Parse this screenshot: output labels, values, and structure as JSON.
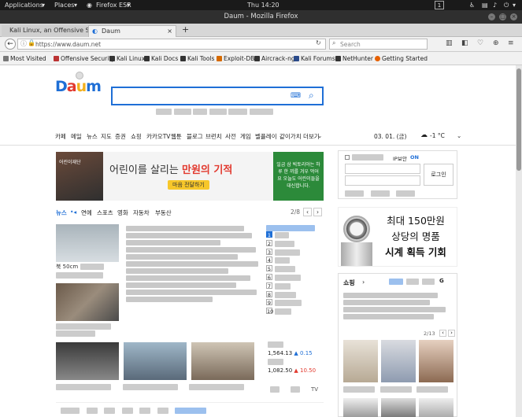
{
  "system": {
    "applications": "Applications",
    "places": "Places",
    "browser": "Firefox ESR",
    "clock": "Thu 14:20",
    "workspace": "1"
  },
  "window": {
    "title": "Daum - Mozilla Firefox"
  },
  "tabs": [
    {
      "label": "Kali Linux, an Offensive S..."
    },
    {
      "label": "Daum"
    }
  ],
  "address": {
    "url": "https://www.daum.net",
    "search_placeholder": "Search"
  },
  "bookmarks": [
    "Most Visited",
    "Offensive Security",
    "Kali Linux",
    "Kali Docs",
    "Kali Tools",
    "Exploit-DB",
    "Aircrack-ng",
    "Kali Forums",
    "NetHunter",
    "Getting Started"
  ],
  "daum": {
    "logo": "Daum",
    "menu": [
      "카페",
      "메일",
      "뉴스",
      "지도",
      "증권",
      "쇼핑",
      "카카오TV",
      "웹툰",
      "블로그",
      "브런치",
      "사전",
      "게임",
      "벨플레이",
      "같이가치",
      "더보기"
    ],
    "date": "03. 01. (금)",
    "weather": "-1 °C",
    "banner": {
      "org": "어린이재단",
      "headline_pre": "어린이를 살리는 ",
      "headline_em": "만원의 기적",
      "button": "마음 전달하기",
      "side": "일금 삼 빅토리아는 하루 한 끼를 겨우 먹어요 오늘도 어린이들을 대신합니다."
    },
    "news_tabs": [
      "뉴스",
      "연예",
      "스포츠",
      "영화",
      "자동차",
      "부동산"
    ],
    "news_page": "2/8",
    "news_captions": [
      "북 50cm",
      "",
      "",
      "",
      ""
    ],
    "ranks": [
      "1",
      "2",
      "3",
      "4",
      "5",
      "6",
      "7",
      "8",
      "9",
      "10"
    ],
    "stocks": [
      {
        "value": "1,564.13",
        "change": "▲ 0.15"
      },
      {
        "value": "1,082.50",
        "change": "▲ 10.50"
      }
    ],
    "stock_tab": "TV",
    "login": {
      "ip": "IP보안",
      "on": "ON",
      "button": "로그인"
    },
    "ad": {
      "line1": "최대 150만원",
      "line2": "상당의 명품",
      "line3": "시계 획득 기회"
    },
    "shopping": {
      "title": "쇼핑",
      "badge": "G",
      "page": "2/13"
    }
  },
  "colors": {
    "accent": "#1f6fd6",
    "dark": "#111111",
    "titlebar": "#2f2f2f"
  }
}
